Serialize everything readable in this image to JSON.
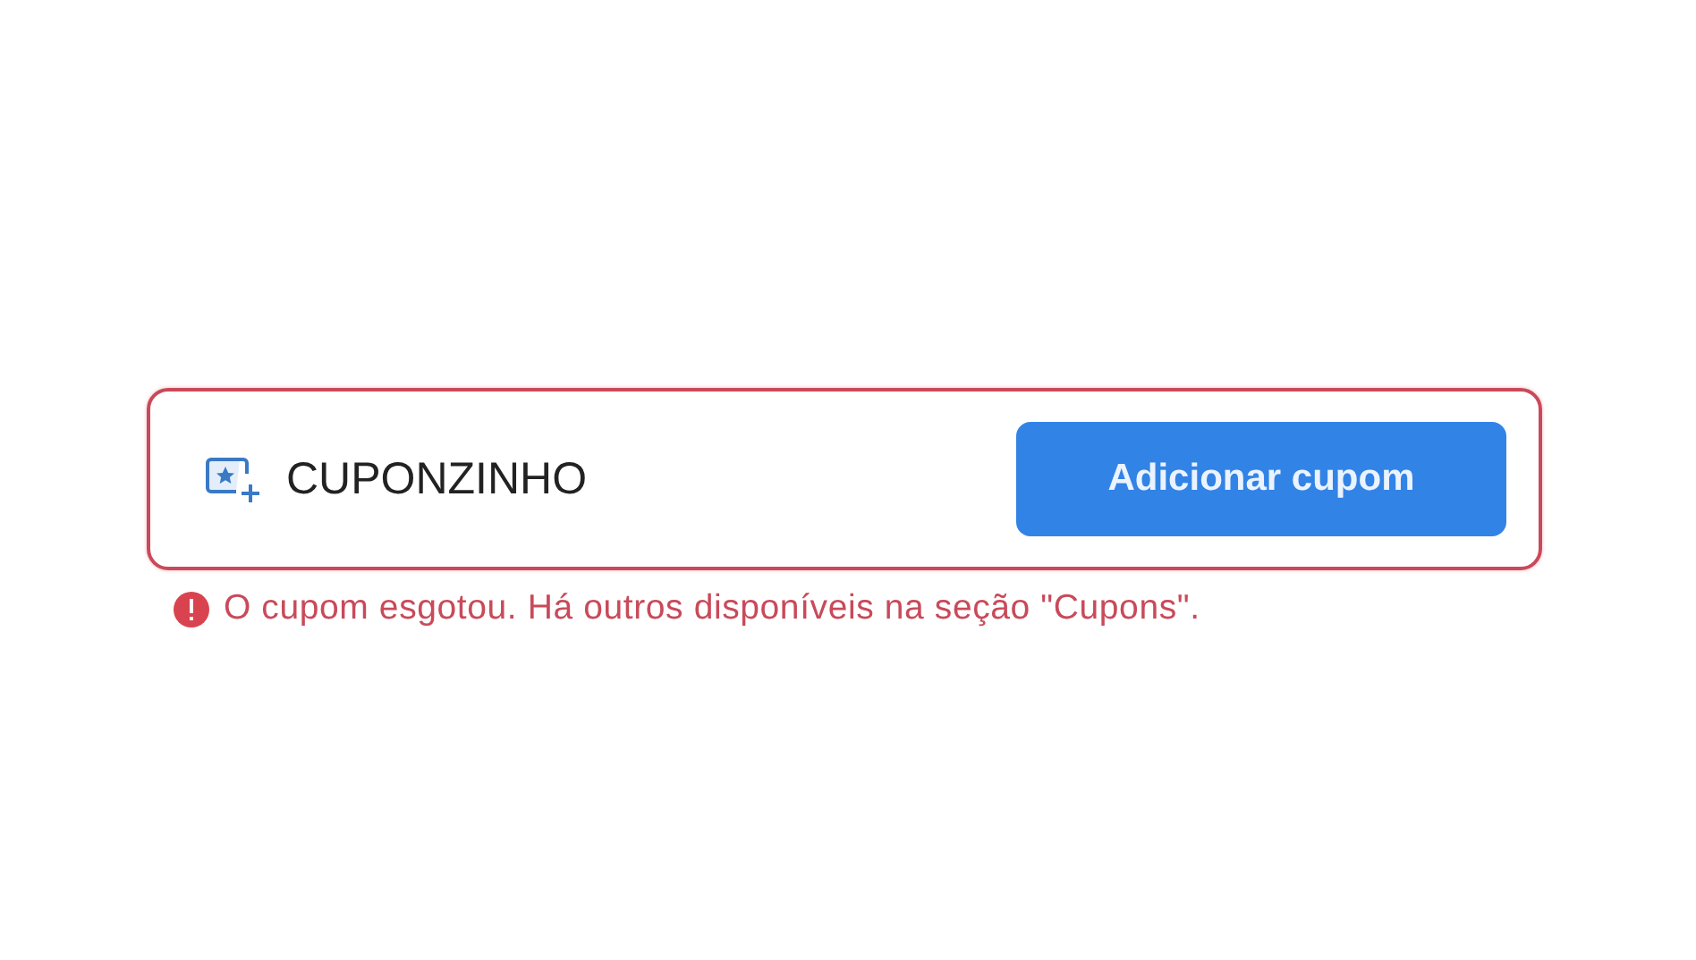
{
  "coupon_field": {
    "value": "CUPONZINHO",
    "error": true
  },
  "add_button": {
    "label": "Adicionar cupom"
  },
  "error_message": {
    "text": "O cupom esgotou. Há outros disponíveis na seção \"Cupons\"."
  }
}
